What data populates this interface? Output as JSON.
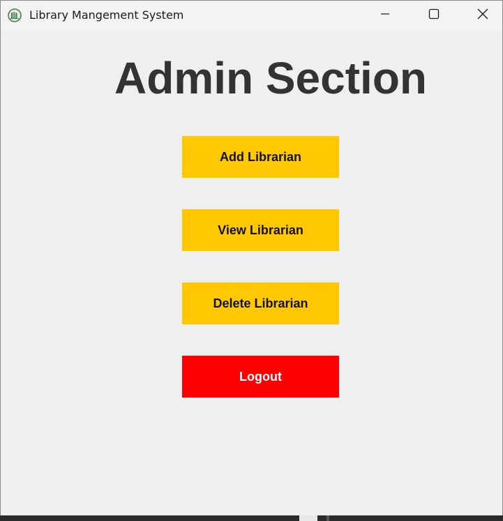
{
  "window": {
    "title": "Library Mangement System",
    "app_icon": "library-app-icon",
    "controls": {
      "minimize_icon": "minimize-icon",
      "maximize_icon": "maximize-icon",
      "close_icon": "close-icon"
    }
  },
  "main": {
    "heading": "Admin Section",
    "buttons": {
      "add_librarian": "Add Librarian",
      "view_librarian": "View Librarian",
      "delete_librarian": "Delete Librarian",
      "logout": "Logout"
    }
  },
  "colors": {
    "action_button": "#ffc800",
    "logout_button": "#ff0000",
    "heading_text": "#333333",
    "background": "#efefef"
  }
}
